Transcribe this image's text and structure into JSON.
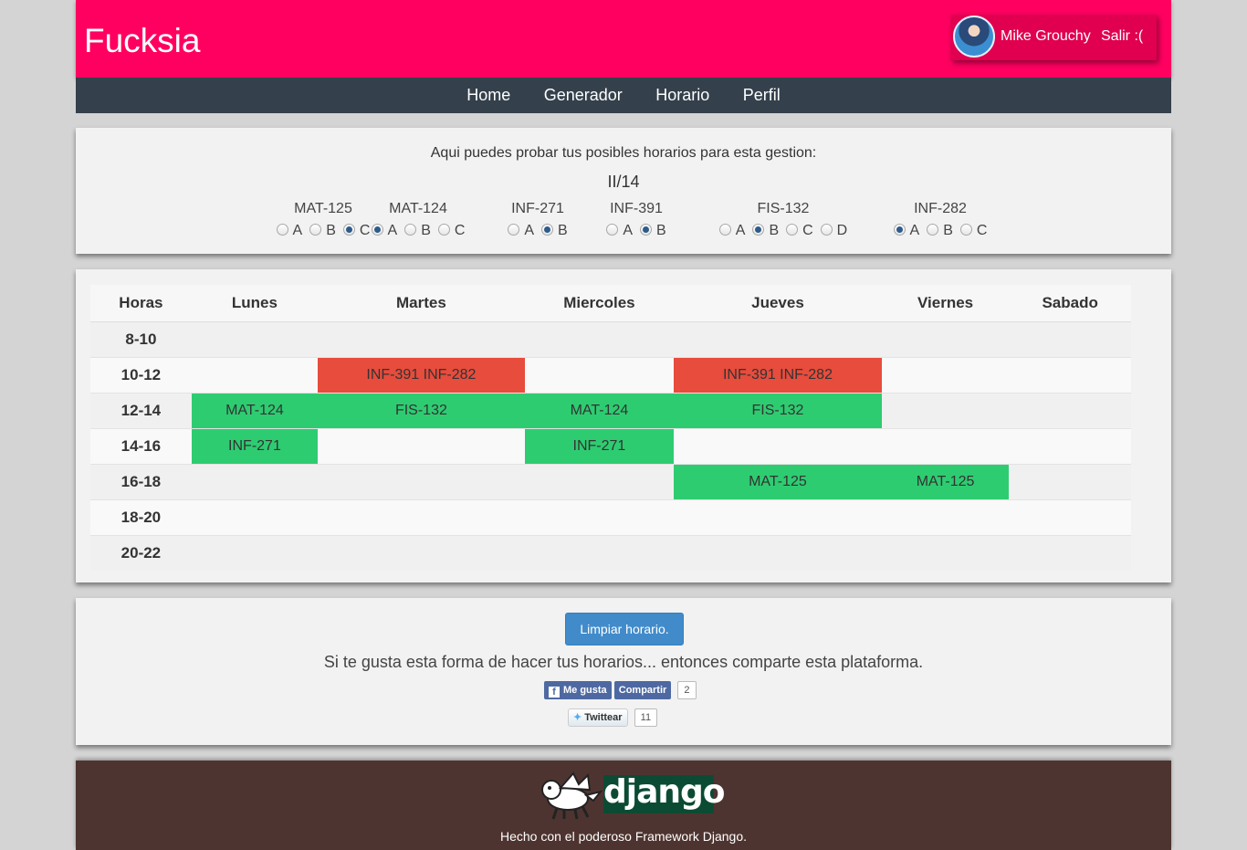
{
  "header": {
    "brand": "Fucksia",
    "user_name": "Mike Grouchy",
    "logout_label": "Salir :("
  },
  "nav": {
    "items": [
      {
        "label": "Home"
      },
      {
        "label": "Generador"
      },
      {
        "label": "Horario"
      },
      {
        "label": "Perfil"
      }
    ]
  },
  "selector": {
    "intro": "Aqui puedes probar tus posibles horarios para esta gestion:",
    "period": "II/14",
    "courses": [
      {
        "name": "MAT-125",
        "options": [
          "A",
          "B",
          "C"
        ],
        "selected": "C"
      },
      {
        "name": "MAT-124",
        "options": [
          "A",
          "B",
          "C"
        ],
        "selected": "A"
      },
      {
        "name": "INF-271",
        "options": [
          "A",
          "B"
        ],
        "selected": "B"
      },
      {
        "name": "INF-391",
        "options": [
          "A",
          "B"
        ],
        "selected": "B"
      },
      {
        "name": "FIS-132",
        "options": [
          "A",
          "B",
          "C",
          "D"
        ],
        "selected": "B"
      },
      {
        "name": "INF-282",
        "options": [
          "A",
          "B",
          "C"
        ],
        "selected": "A"
      }
    ]
  },
  "schedule": {
    "headers": [
      "Horas",
      "Lunes",
      "Martes",
      "Miercoles",
      "Jueves",
      "Viernes",
      "Sabado"
    ],
    "rows": [
      {
        "hour": "8-10",
        "cells": [
          "",
          "",
          "",
          "",
          "",
          ""
        ]
      },
      {
        "hour": "10-12",
        "cells": [
          "",
          "INF-391 INF-282",
          "",
          "INF-391 INF-282",
          "",
          ""
        ]
      },
      {
        "hour": "12-14",
        "cells": [
          "MAT-124",
          "FIS-132",
          "MAT-124",
          "FIS-132",
          "",
          ""
        ]
      },
      {
        "hour": "14-16",
        "cells": [
          "INF-271",
          "",
          "INF-271",
          "",
          "",
          ""
        ]
      },
      {
        "hour": "16-18",
        "cells": [
          "",
          "",
          "",
          "MAT-125",
          "MAT-125",
          ""
        ]
      },
      {
        "hour": "18-20",
        "cells": [
          "",
          "",
          "",
          "",
          "",
          ""
        ]
      },
      {
        "hour": "20-22",
        "cells": [
          "",
          "",
          "",
          "",
          "",
          ""
        ]
      }
    ],
    "colors": {
      "conflict": "#e74c3c",
      "course": "#2ecc71"
    }
  },
  "share": {
    "clear_button": "Limpiar horario.",
    "message": "Si te gusta esta forma de hacer tus horarios... entonces comparte esta plataforma.",
    "fb_like": "Me gusta",
    "fb_share": "Compartir",
    "fb_count": "2",
    "tweet": "Twittear",
    "tweet_count": "11"
  },
  "footer": {
    "logo_text": "django",
    "text": "Hecho con el poderoso Framework Django."
  },
  "colors": {
    "brand": "#ff0060",
    "nav": "#34404b",
    "footer": "#4e3430",
    "button": "#428bca"
  }
}
